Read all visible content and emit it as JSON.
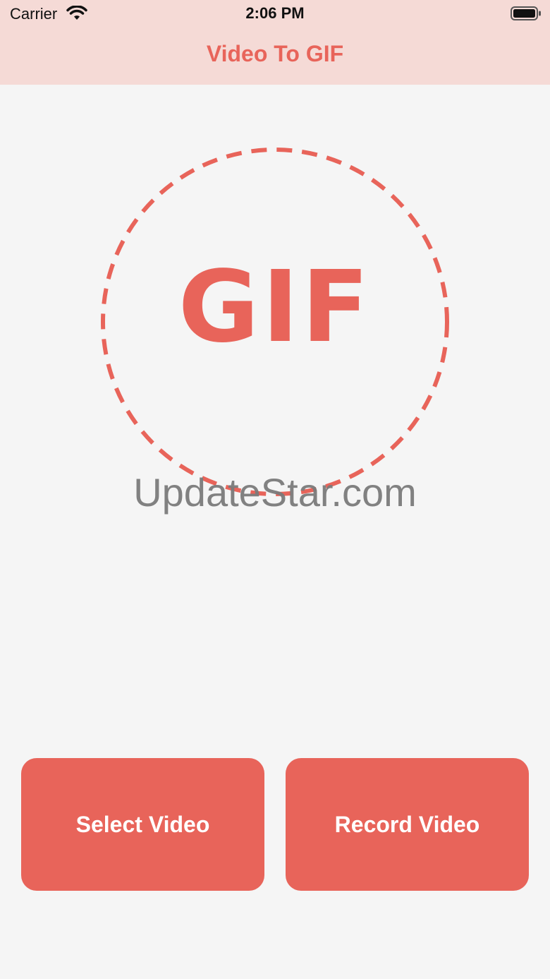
{
  "status_bar": {
    "carrier": "Carrier",
    "time": "2:06 PM",
    "icons": [
      "wifi-icon",
      "battery-icon"
    ]
  },
  "nav": {
    "title": "Video To GIF"
  },
  "hero": {
    "logo_text": "GIF"
  },
  "watermark": {
    "text": "UpdateStar.com"
  },
  "actions": {
    "select_label": "Select Video",
    "record_label": "Record Video"
  },
  "colors": {
    "accent": "#e8645a",
    "nav_background": "#f5dad6",
    "page_background": "#f5f5f5",
    "watermark": "#7b7b7b"
  }
}
